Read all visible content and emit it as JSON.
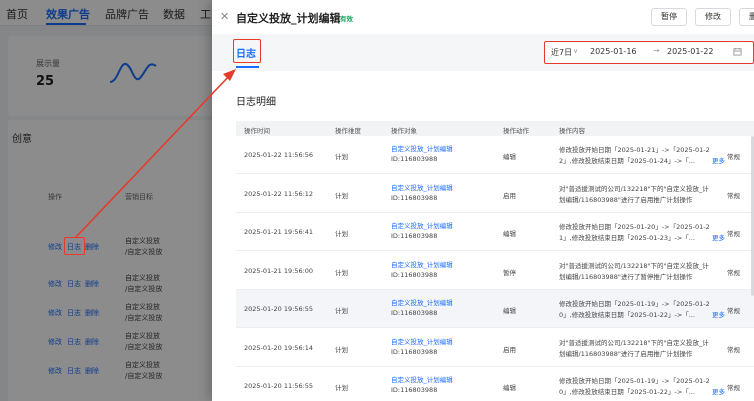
{
  "background": {
    "nav": [
      "首页",
      "效果广告",
      "品牌广告",
      "数据",
      "工"
    ],
    "metric_label": "展示量",
    "metric_value": "25",
    "section_title": "创意",
    "table_headers": [
      "操作",
      "营销目标"
    ],
    "rows": [
      {
        "actions": [
          "修改",
          "日志",
          "删除"
        ],
        "goal": [
          "自定义投放",
          "/自定义投放"
        ]
      },
      {
        "actions": [
          "修改",
          "日志",
          "删除"
        ],
        "goal": [
          "自定义投放",
          "/自定义投放"
        ]
      },
      {
        "actions": [
          "修改",
          "日志",
          "删除"
        ],
        "goal": [
          "自定义投放",
          "/自定义投放"
        ]
      },
      {
        "actions": [
          "修改",
          "日志",
          "删除"
        ],
        "goal": [
          "自定义投放",
          "/自定义投放"
        ]
      },
      {
        "actions": [
          "修改",
          "日志",
          "删除"
        ],
        "goal": [
          "自定义投放",
          "/自定义投放"
        ]
      }
    ]
  },
  "drawer": {
    "close_icon": "close-icon",
    "title": "自定义投放_计划编辑",
    "status": "有效",
    "buttons": {
      "pause": "暂停",
      "edit": "修改",
      "delete": "删"
    },
    "tab": "日志",
    "date": {
      "preset": "近7日",
      "start": "2025-01-16",
      "end": "2025-01-22",
      "arrow": "→"
    },
    "section_title": "日志明细",
    "columns": [
      "操作时间",
      "操作维度",
      "操作对象",
      "操作动作",
      "操作内容"
    ],
    "more_label": "更多",
    "rows": [
      {
        "time": "2025-01-22 11:56:56",
        "level": "计划",
        "object": "自定义投放_计划编辑",
        "id": "ID:116803988",
        "action": "编辑",
        "content1": "修改投放开始日期「2025-01-21」->「2025-01-2",
        "content2": "2」,修改投放结束日期「2025-01-24」->「...",
        "has_more": true,
        "extra": "常规"
      },
      {
        "time": "2025-01-22 11:56:12",
        "level": "计划",
        "object": "自定义投放_计划编辑",
        "id": "ID:116803988",
        "action": "启用",
        "content1": "对\"普适援测试的公司/132218\"下的\"自定义投放_计",
        "content2": "划编辑/116803988\"进行了启用推广计划操作",
        "has_more": false,
        "extra": "常规"
      },
      {
        "time": "2025-01-21 19:56:41",
        "level": "计划",
        "object": "自定义投放_计划编辑",
        "id": "ID:116803988",
        "action": "编辑",
        "content1": "修改投放开始日期「2025-01-20」->「2025-01-2",
        "content2": "1」,修改投放结束日期「2025-01-23」->「...",
        "has_more": true,
        "extra": "常规"
      },
      {
        "time": "2025-01-21 19:56:00",
        "level": "计划",
        "object": "自定义投放_计划编辑",
        "id": "ID:116803988",
        "action": "暂停",
        "content1": "对\"普适援测试的公司/132218\"下的\"自定义投放_计",
        "content2": "划编辑/116803988\"进行了暂停推广计划操作",
        "has_more": false,
        "extra": "常规"
      },
      {
        "time": "2025-01-20 19:56:55",
        "level": "计划",
        "object": "自定义投放_计划编辑",
        "id": "ID:116803988",
        "action": "编辑",
        "content1": "修改投放开始日期「2025-01-19」->「2025-01-2",
        "content2": "0」,修改投放结束日期「2025-01-22」->「...",
        "has_more": true,
        "extra": "常规"
      },
      {
        "time": "2025-01-20 19:56:14",
        "level": "计划",
        "object": "自定义投放_计划编辑",
        "id": "ID:116803988",
        "action": "启用",
        "content1": "对\"普适援测试的公司/132218\"下的\"自定义投放_计",
        "content2": "划编辑/116803988\"进行了启用推广计划操作",
        "has_more": false,
        "extra": "常规"
      },
      {
        "time": "2025-01-20 11:56:55",
        "level": "计划",
        "object": "自定义投放_计划编辑",
        "id": "ID:116803988",
        "action": "编辑",
        "content1": "修改投放开始日期「2025-01-19」->「2025-01-2",
        "content2": "0」,修改投放结束日期「2025-01-22」->「...",
        "has_more": true,
        "extra": "常规"
      }
    ]
  },
  "colors": {
    "accent": "#1a6dff",
    "highlight": "#e53b2c",
    "status_green": "#1aa35c"
  }
}
